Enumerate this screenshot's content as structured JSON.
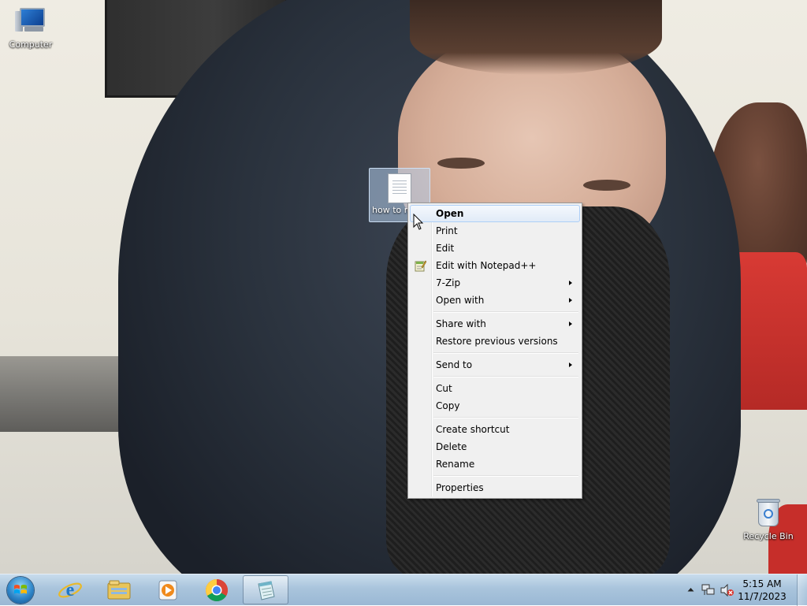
{
  "desktop": {
    "icons": {
      "computer": "Computer",
      "file": "how to m",
      "recycle_bin": "Recycle Bin"
    }
  },
  "context_menu": {
    "items": [
      {
        "label": "Open",
        "default": true
      },
      {
        "label": "Print"
      },
      {
        "label": "Edit"
      },
      {
        "label": "Edit with Notepad++",
        "icon": "notepad-plus-plus-icon"
      },
      {
        "label": "7-Zip",
        "submenu": true
      },
      {
        "label": "Open with",
        "submenu": true
      },
      {
        "label": "Share with",
        "submenu": true
      },
      {
        "label": "Restore previous versions"
      },
      {
        "label": "Send to",
        "submenu": true
      },
      {
        "label": "Cut"
      },
      {
        "label": "Copy"
      },
      {
        "label": "Create shortcut"
      },
      {
        "label": "Delete"
      },
      {
        "label": "Rename"
      },
      {
        "label": "Properties"
      }
    ]
  },
  "taskbar": {
    "pinned": [
      {
        "icon": "internet-explorer-icon"
      },
      {
        "icon": "file-explorer-icon"
      },
      {
        "icon": "media-player-icon"
      },
      {
        "icon": "chrome-icon"
      },
      {
        "icon": "notepad-icon",
        "active": true
      }
    ],
    "clock": {
      "time": "5:15 AM",
      "date": "11/7/2023"
    }
  },
  "colors": {
    "menu_background": "#f0f0f0",
    "menu_highlight": "#e1ebf7",
    "taskbar": "#a9c4dc"
  }
}
